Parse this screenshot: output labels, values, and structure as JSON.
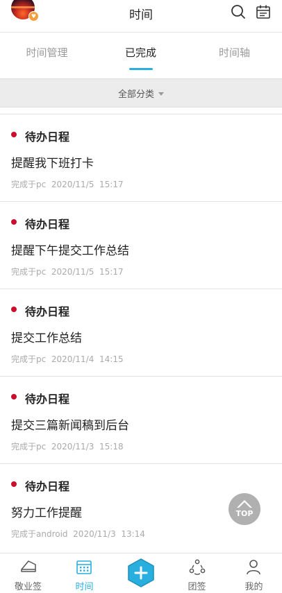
{
  "header": {
    "title": "时间",
    "icons": [
      "avatar",
      "search-icon",
      "calendar-icon"
    ]
  },
  "tabs": [
    {
      "label": "时间管理",
      "active": false
    },
    {
      "label": "已完成",
      "active": true
    },
    {
      "label": "时间轴",
      "active": false
    }
  ],
  "filter": {
    "label": "全部分类"
  },
  "items": [
    {
      "category": "待办日程",
      "title": "提醒我下班打卡",
      "meta": "完成于pc  2020/11/5  15:17"
    },
    {
      "category": "待办日程",
      "title": "提醒下午提交工作总结",
      "meta": "完成于pc  2020/11/5  15:17"
    },
    {
      "category": "待办日程",
      "title": "提交工作总结",
      "meta": "完成于pc  2020/11/4  14:15"
    },
    {
      "category": "待办日程",
      "title": "提交三篇新闻稿到后台",
      "meta": "完成于pc  2020/11/3  15:18"
    },
    {
      "category": "待办日程",
      "title": "努力工作提醒",
      "meta": "完成于android  2020/11/3  13:14"
    }
  ],
  "top_button": {
    "label": "TOP"
  },
  "bottom_nav": [
    {
      "label": "敬业签",
      "active": false
    },
    {
      "label": "时间",
      "active": true
    },
    {
      "label": "团签",
      "active": false
    },
    {
      "label": "我的",
      "active": false
    }
  ],
  "colors": {
    "accent": "#29aee0",
    "dot": "#c8102e"
  }
}
